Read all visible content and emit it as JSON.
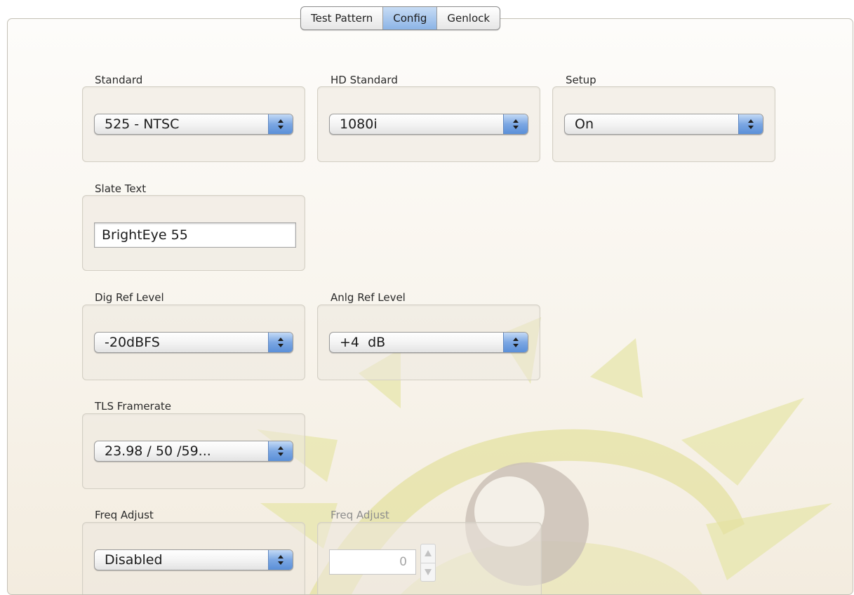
{
  "tabs": [
    {
      "label": "Test Pattern",
      "active": false
    },
    {
      "label": "Config",
      "active": true
    },
    {
      "label": "Genlock",
      "active": false
    }
  ],
  "fields": {
    "standard": {
      "label": "Standard",
      "value": "525 - NTSC"
    },
    "hd_standard": {
      "label": "HD Standard",
      "value": "1080i"
    },
    "setup": {
      "label": "Setup",
      "value": "On"
    },
    "slate_text": {
      "label": "Slate Text",
      "value": "BrightEye 55"
    },
    "dig_ref_level": {
      "label": "Dig Ref Level",
      "value": "-20dBFS"
    },
    "anlg_ref_level": {
      "label": "Anlg Ref Level",
      "value": "+4  dB"
    },
    "tls_framerate": {
      "label": "TLS Framerate",
      "value": "23.98 / 50 /59..."
    },
    "freq_adjust_mode": {
      "label": "Freq Adjust",
      "value": "Disabled"
    },
    "freq_adjust_value": {
      "label": "Freq Adjust",
      "value": "0",
      "disabled": true
    }
  },
  "colors": {
    "accent_blue": "#7ba7e3",
    "watermark_yellow": "#e6e4a6",
    "watermark_gray": "#c9bfb4"
  }
}
